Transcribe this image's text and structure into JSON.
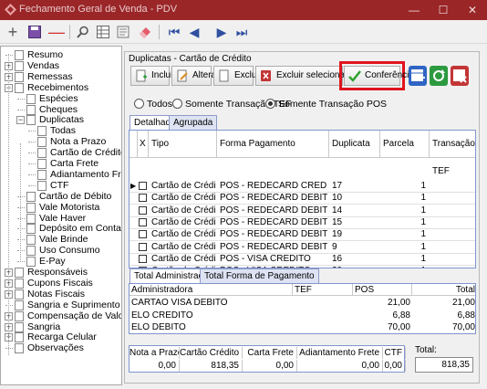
{
  "window": {
    "title": "Fechamento Geral de Venda - PDV",
    "min": "—",
    "max": "☐",
    "close": "✕"
  },
  "tree": [
    {
      "label": "Resumo",
      "level": 0,
      "exp": ""
    },
    {
      "label": "Vendas",
      "level": 0,
      "exp": "+"
    },
    {
      "label": "Remessas",
      "level": 0,
      "exp": "+"
    },
    {
      "label": "Recebimentos",
      "level": 0,
      "exp": "−"
    },
    {
      "label": "Espécies",
      "level": 1,
      "exp": ""
    },
    {
      "label": "Cheques",
      "level": 1,
      "exp": ""
    },
    {
      "label": "Duplicatas",
      "level": 1,
      "exp": "−"
    },
    {
      "label": "Todas",
      "level": 2,
      "exp": ""
    },
    {
      "label": "Nota a Prazo",
      "level": 2,
      "exp": ""
    },
    {
      "label": "Cartão de Crédito",
      "level": 2,
      "exp": "",
      "selected": true
    },
    {
      "label": "Carta Frete",
      "level": 2,
      "exp": ""
    },
    {
      "label": "Adiantamento Frete",
      "level": 2,
      "exp": ""
    },
    {
      "label": "CTF",
      "level": 2,
      "exp": ""
    },
    {
      "label": "Cartão de Débito",
      "level": 1,
      "exp": ""
    },
    {
      "label": "Vale Motorista",
      "level": 1,
      "exp": ""
    },
    {
      "label": "Vale Haver",
      "level": 1,
      "exp": ""
    },
    {
      "label": "Depósito em Conta",
      "level": 1,
      "exp": ""
    },
    {
      "label": "Vale Brinde",
      "level": 1,
      "exp": ""
    },
    {
      "label": "Uso Consumo",
      "level": 1,
      "exp": ""
    },
    {
      "label": "E-Pay",
      "level": 1,
      "exp": ""
    },
    {
      "label": "Responsáveis",
      "level": 0,
      "exp": "+"
    },
    {
      "label": "Cupons Fiscais",
      "level": 0,
      "exp": "+"
    },
    {
      "label": "Notas Fiscais",
      "level": 0,
      "exp": "+"
    },
    {
      "label": "Sangria e Suprimento",
      "level": 0,
      "exp": ""
    },
    {
      "label": "Compensação de Valores",
      "level": 0,
      "exp": "+"
    },
    {
      "label": "Sangria",
      "level": 0,
      "exp": "+"
    },
    {
      "label": "Recarga Celular",
      "level": 0,
      "exp": "+"
    },
    {
      "label": "Observações",
      "level": 0,
      "exp": ""
    }
  ],
  "panel": {
    "title": "Duplicatas - Cartão de Crédito"
  },
  "buttons": {
    "incluir": "Incluir",
    "alterar": "Alterar",
    "excluir": "Excluir",
    "excluir_sel": "Excluir selecionados",
    "conferencia": "Conferência"
  },
  "filters": {
    "todos": "Todos",
    "tef": "Somente Transação TEF",
    "pos": "Somente Transação POS",
    "selected": "pos"
  },
  "tabs": {
    "detalhada": "Detalhada",
    "agrupada": "Agrupada"
  },
  "columns": {
    "x": "X",
    "tipo": "Tipo",
    "forma": "Forma Pagamento",
    "duplicata": "Duplicata",
    "parcela": "Parcela",
    "transacao": "Transação TEF"
  },
  "rows": [
    {
      "tipo": "Cartão de Crédito",
      "forma": "POS - REDECARD CREDITO",
      "duplicata": "17",
      "parcela": "1"
    },
    {
      "tipo": "Cartão de Crédito",
      "forma": "POS - REDECARD DEBITO",
      "duplicata": "10",
      "parcela": "1"
    },
    {
      "tipo": "Cartão de Crédito",
      "forma": "POS - REDECARD DEBITO",
      "duplicata": "14",
      "parcela": "1"
    },
    {
      "tipo": "Cartão de Crédito",
      "forma": "POS - REDECARD DEBITO",
      "duplicata": "15",
      "parcela": "1"
    },
    {
      "tipo": "Cartão de Crédito",
      "forma": "POS - REDECARD DEBITO",
      "duplicata": "19",
      "parcela": "1"
    },
    {
      "tipo": "Cartão de Crédito",
      "forma": "POS - REDECARD DEBITO",
      "duplicata": "9",
      "parcela": "1"
    },
    {
      "tipo": "Cartão de Crédito",
      "forma": "POS - VISA CREDITO",
      "duplicata": "16",
      "parcela": "1"
    },
    {
      "tipo": "Cartão de Crédito",
      "forma": "POS - VISA CREDITO",
      "duplicata": "20",
      "parcela": "1"
    },
    {
      "tipo": "Cartão de Crédito",
      "forma": "POS - VISA CREDITO",
      "duplicata": "17",
      "parcela": "1"
    }
  ],
  "tabs2": {
    "admin": "Total Administradora",
    "forma": "Total Forma de Pagamento"
  },
  "totcols": {
    "admin": "Administradora",
    "tef": "TEF",
    "pos": "POS",
    "total": "Total"
  },
  "totrows": [
    {
      "admin": "CARTAO VISA DEBITO",
      "tef": "",
      "pos": "21,00",
      "total": "21,00"
    },
    {
      "admin": "ELO CREDITO",
      "tef": "",
      "pos": "6,88",
      "total": "6,88"
    },
    {
      "admin": "ELO DEBITO",
      "tef": "",
      "pos": "70,00",
      "total": "70,00"
    }
  ],
  "footer": {
    "labels": [
      "Nota a Prazo",
      "Cartão Crédito",
      "Carta Frete",
      "Adiantamento Frete",
      "CTF"
    ],
    "values": [
      "0,00",
      "818,35",
      "0,00",
      "0,00",
      "0,00"
    ],
    "total_label": "Total:",
    "total_value": "818,35"
  }
}
